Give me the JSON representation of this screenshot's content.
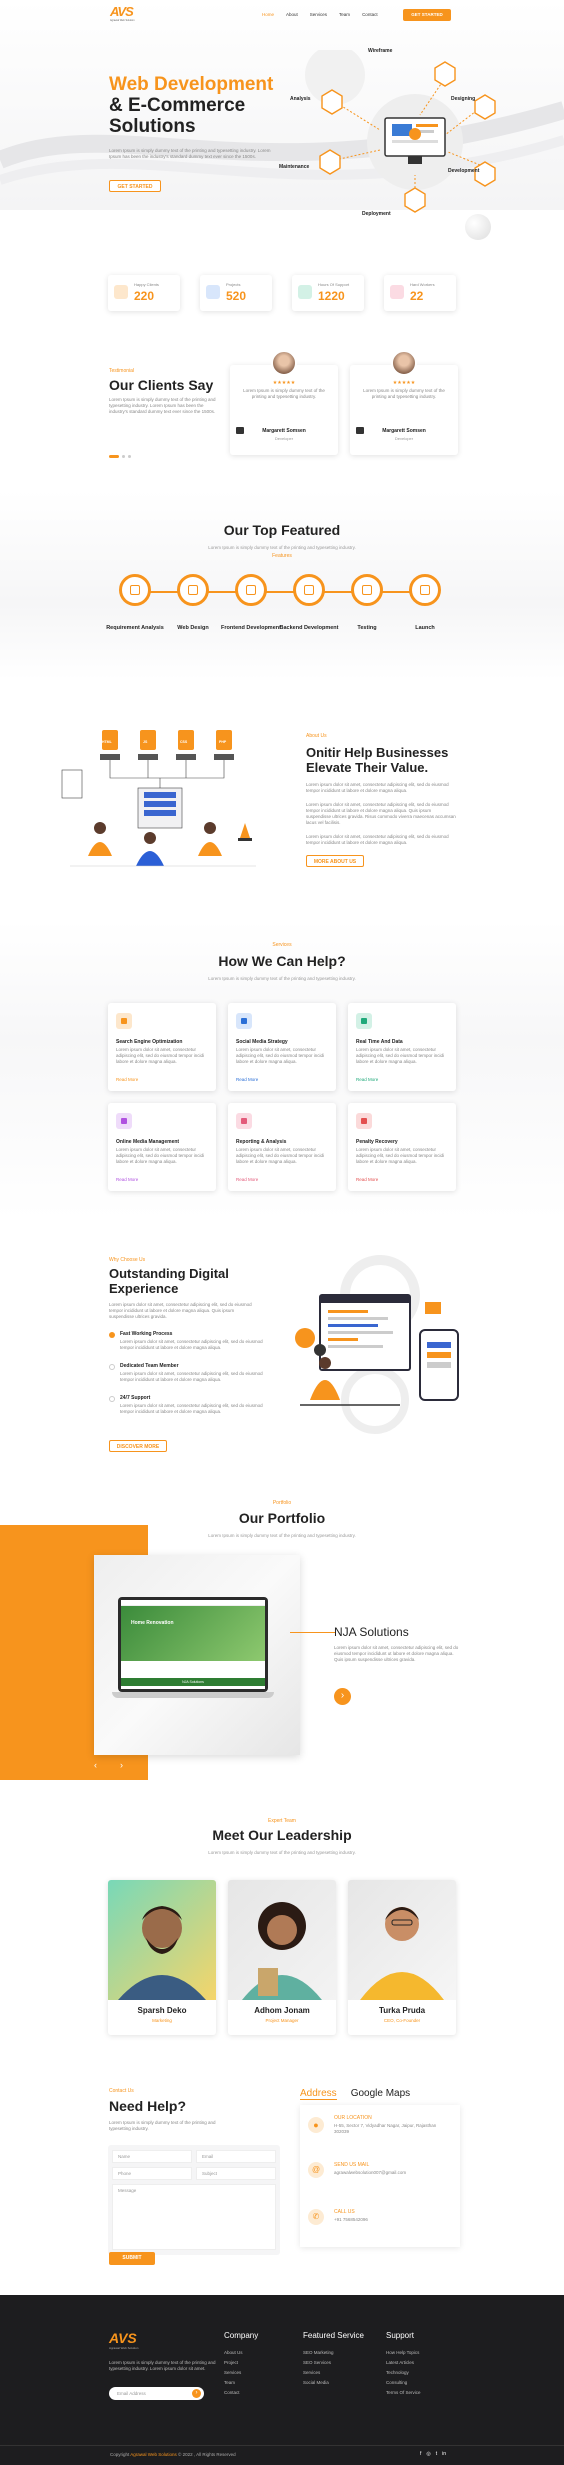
{
  "nav": {
    "logo": "AVS",
    "logo_sub": "Agrawal Web Solution",
    "links": [
      "Home",
      "About",
      "Services",
      "Team",
      "Contact"
    ],
    "cta": "GET STARTED"
  },
  "hero": {
    "line1": "Web Development",
    "line2": "& E-Commerce",
    "line3": "Solutions",
    "desc": "Lorem Ipsum is simply dummy text of the printing and typesetting industry. Lorem Ipsum has been the industry's standard dummy text ever since the 1500s.",
    "btn": "GET STARTED",
    "nodes": [
      "Wireframe",
      "Analysis",
      "Designing",
      "Maintenance",
      "Development",
      "Deployment"
    ]
  },
  "stats": [
    {
      "label": "Happy Clients",
      "value": "220",
      "color": "#f7941d"
    },
    {
      "label": "Projects",
      "value": "520",
      "color": "#2b6fd6"
    },
    {
      "label": "Hours Of Support",
      "value": "1220",
      "color": "#1fa97a"
    },
    {
      "label": "Hard Workers",
      "value": "22",
      "color": "#e35a7a"
    }
  ],
  "testimonials": {
    "tag": "Testimonial",
    "title": "Our Clients Say",
    "desc": "Lorem Ipsum is simply dummy text of the printing and typesetting industry. Lorem Ipsum has been the industry's standard dummy text ever since the 1500s.",
    "items": [
      {
        "text": "Lorem Ipsum is simply dummy text of the printing and typesetting industry.",
        "name": "Margarett Somsen",
        "role": "Developer"
      },
      {
        "text": "Lorem Ipsum is simply dummy text of the printing and typesetting industry.",
        "name": "Margarett Somsen",
        "role": "Developer"
      }
    ]
  },
  "featured": {
    "tag": "Features",
    "title": "Our Top Featured",
    "desc": "Lorem Ipsum is simply dummy text of the printing and typesetting industry.",
    "steps": [
      "Requirement Analysis",
      "Web Design",
      "Frontend Development",
      "Backend Development",
      "Testing",
      "Launch"
    ]
  },
  "about": {
    "tag": "About Us",
    "title1": "Onitir Help Businesses",
    "title2": "Elevate Their Value.",
    "p1": "Lorem ipsum dolor sit amet, consectetur adipiscing elit, sed do eiusmod tempor incididunt ut labore et dolore magna aliqua.",
    "p2": "Lorem ipsum dolor sit amet, consectetur adipiscing elit, sed do eiusmod tempor incididunt ut labore et dolore magna aliqua. Quis ipsum suspendisse ultrices gravida. Risus commodo viverra maecenas accumsan lacus vel facilisis.",
    "p3": "Lorem ipsum dolor sit amet, consectetur adipiscing elit, sed do eiusmod tempor incididunt ut labore et dolore magna aliqua.",
    "btn": "MORE ABOUT US",
    "file_labels": [
      "HTML",
      "JS",
      "CSS",
      "PHP"
    ]
  },
  "services": {
    "tag": "Services",
    "title": "How We Can Help?",
    "desc": "Lorem Ipsum is simply dummy text of the printing and typesetting industry.",
    "items": [
      {
        "title": "Search Engine Optimization",
        "text": "Lorem ipsum dolor sit amet, consectetur adipiscing elit, sed do eiusmod tempor incidi labore et dolore magna aliqua.",
        "link": "Read More",
        "color": "#f7941d"
      },
      {
        "title": "Social Media Strategy",
        "text": "Lorem ipsum dolor sit amet, consectetur adipiscing elit, sed do eiusmod tempor incidi labore et dolore magna aliqua.",
        "link": "Read More",
        "color": "#2b6fd6"
      },
      {
        "title": "Real Time And Data",
        "text": "Lorem ipsum dolor sit amet, consectetur adipiscing elit, sed do eiusmod tempor incidi labore et dolore magna aliqua.",
        "link": "Read More",
        "color": "#1fa97a"
      },
      {
        "title": "Online Media Management",
        "text": "Lorem ipsum dolor sit amet, consectetur adipiscing elit, sed do eiusmod tempor incidi labore et dolore magna aliqua.",
        "link": "Read More",
        "color": "#b052e0"
      },
      {
        "title": "Reporting & Analysis",
        "text": "Lorem ipsum dolor sit amet, consectetur adipiscing elit, sed do eiusmod tempor incidi labore et dolore magna aliqua.",
        "link": "Read More",
        "color": "#e35a7a"
      },
      {
        "title": "Penalty Recovery",
        "text": "Lorem ipsum dolor sit amet, consectetur adipiscing elit, sed do eiusmod tempor incidi labore et dolore magna aliqua.",
        "link": "Read More",
        "color": "#e34f4f"
      }
    ]
  },
  "why": {
    "tag": "Why Choose Us",
    "title1": "Outstanding Digital",
    "title2": "Experience",
    "desc": "Lorem ipsum dolor sit amet, consectetur adipiscing elit, sed do eiusmod tempor incididunt ut labore et dolore magna aliqua. Quis ipsum suspendisse ultrices gravida.",
    "items": [
      {
        "title": "Fast Working Process",
        "text": "Lorem ipsum dolor sit amet, consectetur adipiscing elit, sed do eiusmod tempor incididunt ut labore et dolore magna aliqua."
      },
      {
        "title": "Dedicated Team Member",
        "text": "Lorem ipsum dolor sit amet, consectetur adipiscing elit, sed do eiusmod tempor incididunt ut labore et dolore magna aliqua."
      },
      {
        "title": "24/7 Support",
        "text": "Lorem ipsum dolor sit amet, consectetur adipiscing elit, sed do eiusmod tempor incididunt ut labore et dolore magna aliqua."
      }
    ],
    "btn": "DISCOVER MORE"
  },
  "portfolio": {
    "tag": "Portfolio",
    "title": "Our Portfolio",
    "desc": "Lorem Ipsum is simply dummy text of the printing and typesetting industry.",
    "project": "NJA Solutions",
    "project_desc": "Lorem ipsum dolor sit amet, consectetur adipiscing elit, sed do eiusmod tempor incididunt ut labore et dolore magna aliqua. Quis ipsum suspendisse ultrices gravida.",
    "screen_title": "Home Renovation",
    "screen_banner": "NJA Solutions",
    "prev": "‹",
    "next": "›",
    "go": "›"
  },
  "team": {
    "tag": "Expert Team",
    "title": "Meet Our Leadership",
    "desc": "Lorem Ipsum is simply dummy text of the printing and typesetting industry.",
    "members": [
      {
        "name": "Sparsh Deko",
        "role": "Marketing"
      },
      {
        "name": "Adhom Jonam",
        "role": "Project Manager"
      },
      {
        "name": "Turka Pruda",
        "role": "CEO, Co-Founder"
      }
    ]
  },
  "contact": {
    "tag": "Contact Us",
    "title": "Need Help?",
    "desc": "Lorem Ipsum is simply dummy text of the printing and typesetting industry.",
    "name_ph": "Name",
    "email_ph": "Email",
    "phone_ph": "Phone",
    "subject_ph": "Subject",
    "message_ph": "Message",
    "submit": "SUBMIT",
    "tabs": [
      "Address",
      "Google Maps"
    ],
    "location_h": "OUR LOCATION",
    "location": "H-55, Sector 7, Vidyadhar Nagar, Jaipur, Rajasthan 302039",
    "email_h": "SEND US MAIL",
    "email": "agrawalwebsolution007@gmail.com",
    "call_h": "CALL US",
    "phone": "+91 7568542096"
  },
  "footer": {
    "logo": "AVS",
    "logo_sub": "Agrawal Web Solution",
    "about": "Lorem Ipsum is simply dummy text of the printing and typesetting industry. Lorem ipsum dolor sit amet.",
    "email_ph": "Email Address",
    "cols": [
      {
        "title": "Company",
        "links": [
          "About Us",
          "Project",
          "Services",
          "Team",
          "Contact"
        ]
      },
      {
        "title": "Featured Service",
        "links": [
          "SEO Marketing",
          "SEO Services",
          "Services",
          "Social Media"
        ]
      },
      {
        "title": "Support",
        "links": [
          "How Help Topics",
          "Latest Articles",
          "Technology",
          "Consulting",
          "Terms Of Service"
        ]
      }
    ],
    "copy_prefix": "Copyright",
    "copy_brand": "Agrawal Web Solutions",
    "copy_suffix": "© 2022 , All Rights Reserved",
    "social": [
      "f",
      "◎",
      "t",
      "in"
    ]
  }
}
